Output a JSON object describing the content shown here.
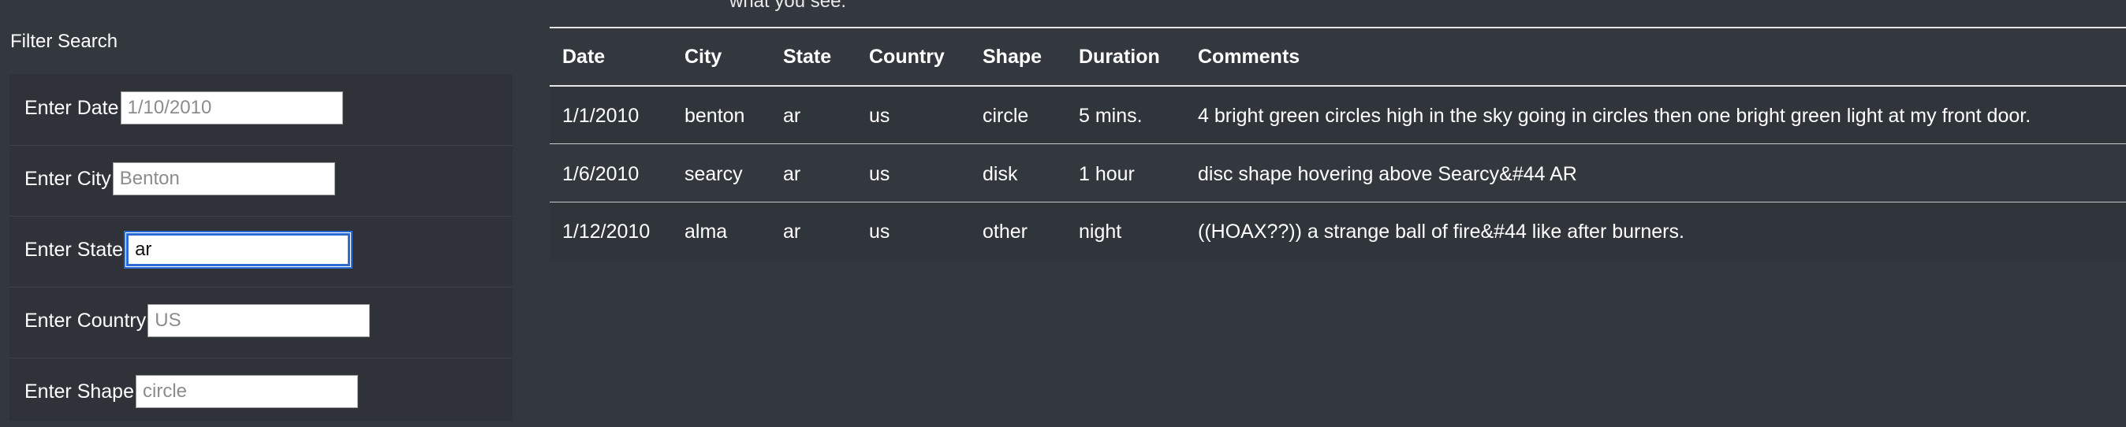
{
  "top_text": "what you see.",
  "filter": {
    "title": "Filter Search",
    "fields": [
      {
        "label": "Enter Date",
        "value": "",
        "placeholder": "1/10/2010"
      },
      {
        "label": "Enter City",
        "value": "",
        "placeholder": "Benton"
      },
      {
        "label": "Enter State",
        "value": "ar",
        "placeholder": ""
      },
      {
        "label": "Enter Country",
        "value": "",
        "placeholder": "US"
      },
      {
        "label": "Enter Shape",
        "value": "",
        "placeholder": "circle"
      }
    ]
  },
  "table": {
    "headers": [
      "Date",
      "City",
      "State",
      "Country",
      "Shape",
      "Duration",
      "Comments"
    ],
    "rows": [
      [
        "1/1/2010",
        "benton",
        "ar",
        "us",
        "circle",
        "5 mins.",
        "4 bright green circles high in the sky going in circles then one bright green light at my front door."
      ],
      [
        "1/6/2010",
        "searcy",
        "ar",
        "us",
        "disk",
        "1 hour",
        "disc shape hovering above Searcy&#44 AR"
      ],
      [
        "1/12/2010",
        "alma",
        "ar",
        "us",
        "other",
        "night",
        "((HOAX??)) a strange ball of fire&#44 like after burners."
      ]
    ]
  }
}
